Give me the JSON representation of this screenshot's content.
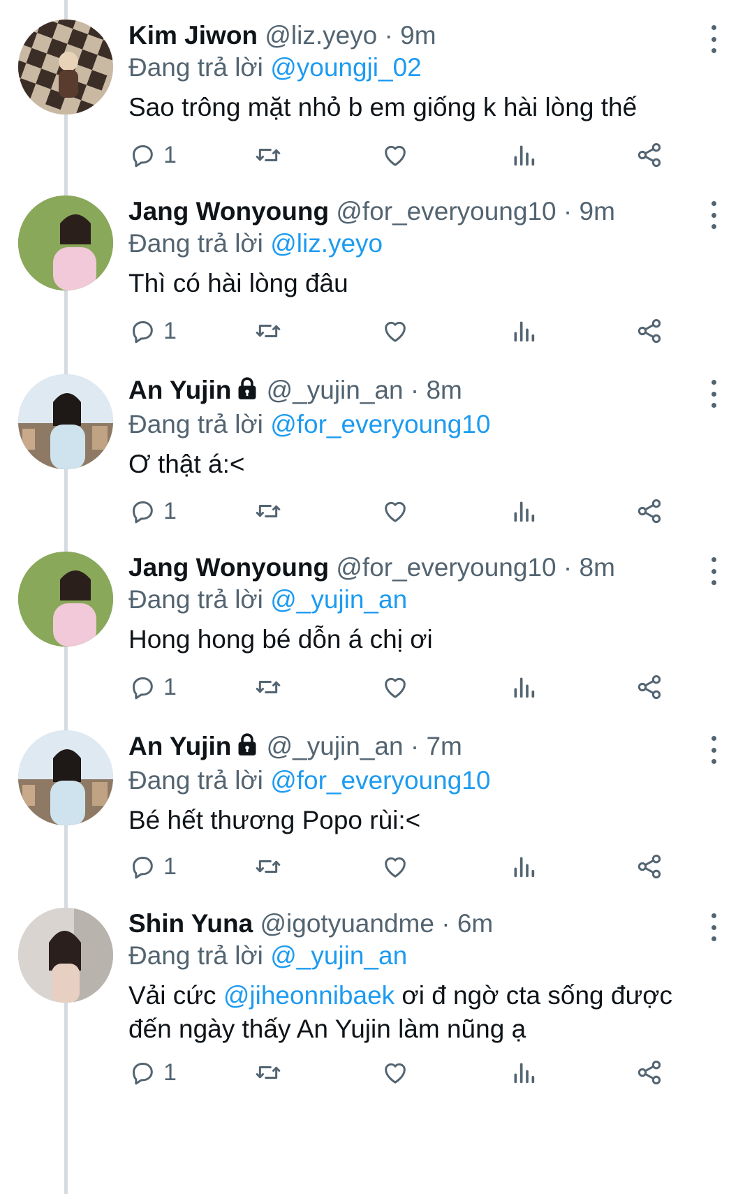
{
  "reply_prefix": "Đang trả lời",
  "colors": {
    "mention": "#1d9bf0",
    "secondary": "#536471",
    "thread_line": "#d5dbe0"
  },
  "tweets": [
    {
      "name": "Kim Jiwon",
      "handle": "@liz.yeyo",
      "dot": "·",
      "time": "9m",
      "locked": false,
      "replying_to": "@youngji_02",
      "text": [
        {
          "t": "Sao trông mặt nhỏ b em giống k hài lòng thế"
        }
      ],
      "reply_count": "1",
      "avatar": {
        "bg": "#c9b9a3",
        "fg": "#3b2e27",
        "pattern": "checker"
      }
    },
    {
      "name": "Jang Wonyoung",
      "handle": "@for_everyoung10",
      "dot": "·",
      "time": "9m",
      "locked": false,
      "replying_to": "@liz.yeyo",
      "text": [
        {
          "t": "Thì có hài lòng đâu"
        }
      ],
      "reply_count": "1",
      "avatar": {
        "bg": "#6f8f4a",
        "fg": "#f1c9d8",
        "pattern": "grass"
      }
    },
    {
      "name": "An Yujin",
      "handle": "@_yujin_an",
      "dot": "·",
      "time": "8m",
      "locked": true,
      "replying_to": "@for_everyoung10",
      "text": [
        {
          "t": "Ơ thật á:<"
        }
      ],
      "reply_count": "1",
      "avatar": {
        "bg": "#a9c3d8",
        "fg": "#cfe3ef",
        "pattern": "city"
      }
    },
    {
      "name": "Jang Wonyoung",
      "handle": "@for_everyoung10",
      "dot": "·",
      "time": "8m",
      "locked": false,
      "replying_to": "@_yujin_an",
      "text": [
        {
          "t": "Hong hong bé dỗn á chị ơi"
        }
      ],
      "reply_count": "1",
      "avatar": {
        "bg": "#6f8f4a",
        "fg": "#f1c9d8",
        "pattern": "grass"
      }
    },
    {
      "name": "An Yujin",
      "handle": "@_yujin_an",
      "dot": "·",
      "time": "7m",
      "locked": true,
      "replying_to": "@for_everyoung10",
      "text": [
        {
          "t": "Bé hết thương Popo rùi:<"
        }
      ],
      "reply_count": "1",
      "avatar": {
        "bg": "#a9c3d8",
        "fg": "#cfe3ef",
        "pattern": "city"
      }
    },
    {
      "name": "Shin Yuna",
      "handle": "@igotyuandme",
      "dot": "·",
      "time": "6m",
      "locked": false,
      "replying_to": "@_yujin_an",
      "text": [
        {
          "t": "Vải cức "
        },
        {
          "t": "@jiheonnibaek",
          "mention": true
        },
        {
          "t": " ơi đ ngờ cta sống được đến ngày  thấy An Yujin làm nũng ạ"
        }
      ],
      "reply_count": "1",
      "avatar": {
        "bg": "#d9d4cf",
        "fg": "#2a1f1d",
        "pattern": "portrait"
      }
    }
  ]
}
